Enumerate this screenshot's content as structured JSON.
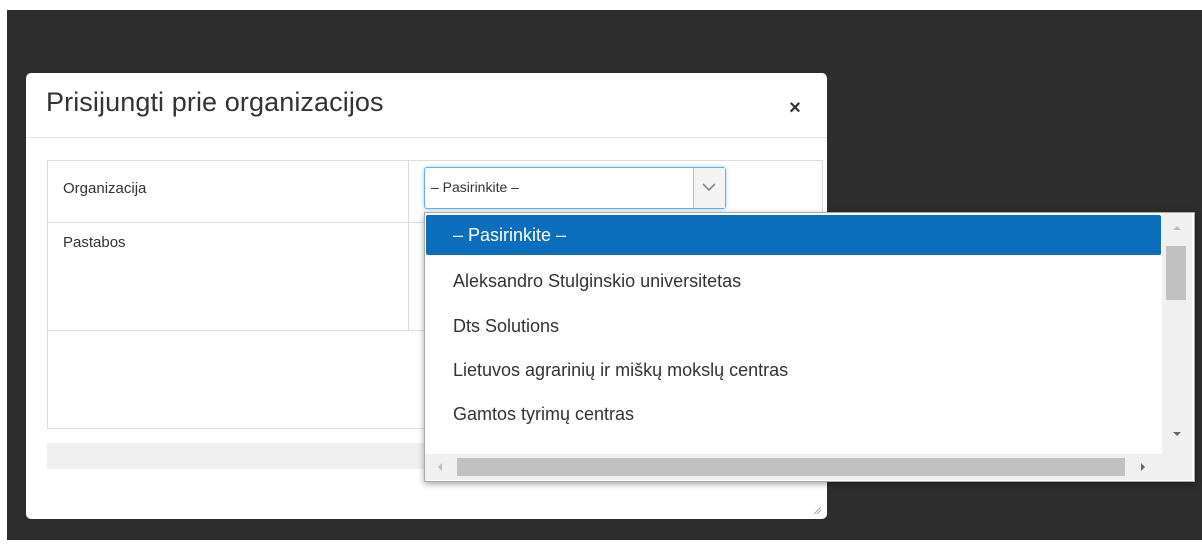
{
  "dialog": {
    "title": "Prisijungti prie organizacijos",
    "close_label": "×"
  },
  "form": {
    "organization_label": "Organizacija",
    "notes_label": "Pastabos",
    "organization_selected": "– Pasirinkite –"
  },
  "dropdown": {
    "options": [
      "– Pasirinkite –",
      "Aleksandro Stulginskio universitetas",
      "Dts Solutions",
      "Lietuvos agrarinių ir miškų mokslų centras",
      "Gamtos tyrimų centras"
    ],
    "selected_index": 0
  },
  "colors": {
    "backdrop": "#2d2d2d",
    "selected_option_bg": "#0a6ebd",
    "focus_border": "#66afe9"
  }
}
